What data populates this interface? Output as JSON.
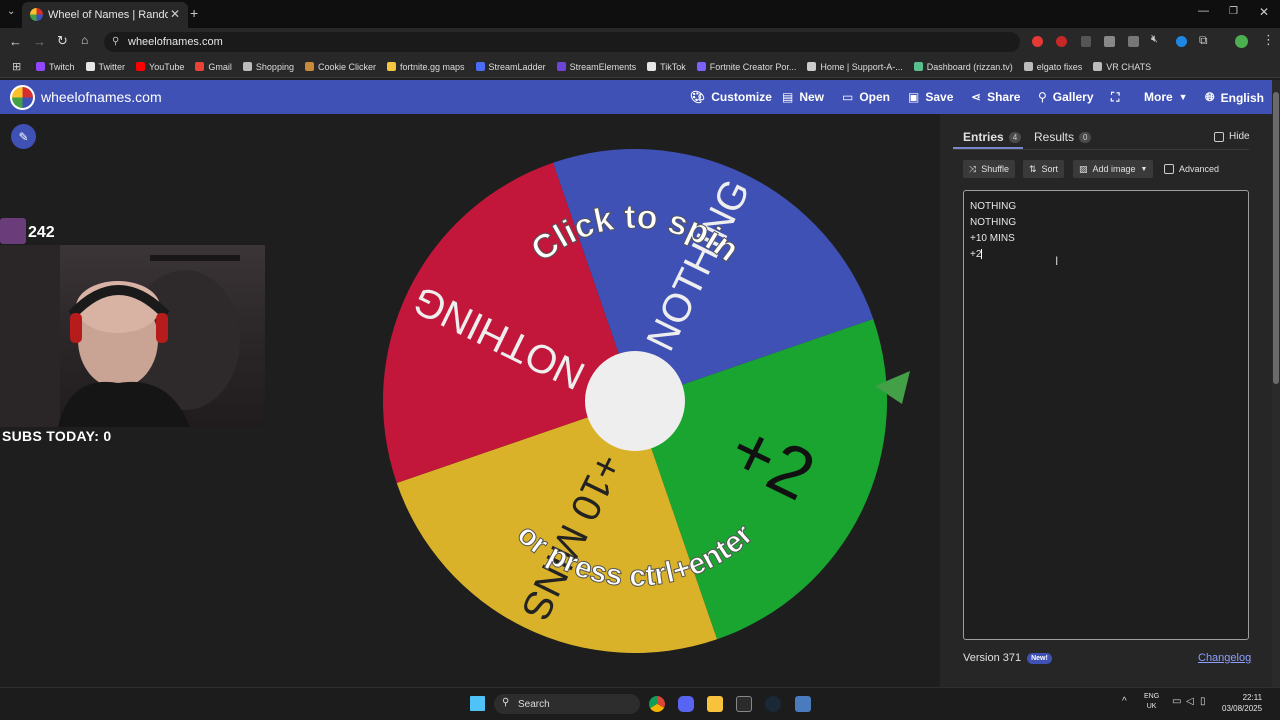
{
  "browser": {
    "tab_title": "Wheel of Names | Random nam",
    "url": "wheelofnames.com",
    "bookmarks": [
      {
        "label": "Twitch",
        "color": "#9146ff"
      },
      {
        "label": "Twitter",
        "color": "#e6e6e6"
      },
      {
        "label": "YouTube",
        "color": "#ff0000"
      },
      {
        "label": "Gmail",
        "color": "#ea4335"
      },
      {
        "label": "Shopping",
        "color": "#bbbbbb"
      },
      {
        "label": "Cookie Clicker",
        "color": "#c98a3a"
      },
      {
        "label": "fortnite.gg maps",
        "color": "#f5c542"
      },
      {
        "label": "StreamLadder",
        "color": "#4a6cf7"
      },
      {
        "label": "StreamElements",
        "color": "#6d44d8"
      },
      {
        "label": "TikTok",
        "color": "#e6e6e6"
      },
      {
        "label": "Fortnite Creator Por...",
        "color": "#7b61ff"
      },
      {
        "label": "Home | Support-A-...",
        "color": "#cccccc"
      },
      {
        "label": "Dashboard (rizzan.tv)",
        "color": "#57c08e"
      },
      {
        "label": "elgato fixes",
        "color": "#bbbbbb"
      },
      {
        "label": "VR CHATS",
        "color": "#bbbbbb"
      }
    ]
  },
  "site": {
    "name": "wheelofnames.com",
    "nav": {
      "customize": "Customize",
      "new": "New",
      "open": "Open",
      "save": "Save",
      "share": "Share",
      "gallery": "Gallery",
      "more": "More",
      "language": "English"
    }
  },
  "overlay": {
    "sub_number": "242",
    "subs_today": "SUBS TODAY: 0"
  },
  "wheel": {
    "segments": [
      {
        "label": "NOTHING",
        "color": "#3f51b5"
      },
      {
        "label": "+2",
        "color": "#19a530"
      },
      {
        "label": "+10 MINS",
        "color": "#d9b22a"
      },
      {
        "label": "NOTHING",
        "color": "#c2173a"
      }
    ],
    "prompt_top": "Click to spin",
    "prompt_bottom": "or press ctrl+enter",
    "pointer_color": "#43a047"
  },
  "panel": {
    "tabs": [
      {
        "label": "Entries",
        "count": "4"
      },
      {
        "label": "Results",
        "count": "0"
      }
    ],
    "hide_label": "Hide",
    "shuffle": "Shuffle",
    "sort": "Sort",
    "add_image": "Add image",
    "advanced": "Advanced",
    "entries": [
      "NOTHING",
      "NOTHING",
      "+10 MINS",
      "+2"
    ],
    "version": "Version 371",
    "new_badge": "New!",
    "changelog": "Changelog"
  },
  "taskbar": {
    "search": "Search",
    "lang_top": "ENG",
    "lang_bottom": "UK",
    "time": "22:11",
    "date": "03/08/2025"
  }
}
